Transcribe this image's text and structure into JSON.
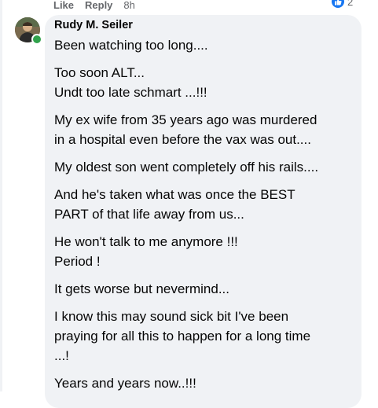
{
  "actions": {
    "like": "Like",
    "reply": "Reply",
    "time": "8h",
    "reaction_count": "2"
  },
  "comment": {
    "author": "Rudy M. Seiler",
    "messages": [
      [
        "Been watching too long...."
      ],
      [
        "Too soon ALT...",
        "Undt too late schmart ...!!!"
      ],
      [
        "My ex wife from 35 years ago was murdered",
        "in a hospital even before the vax was out...."
      ],
      [
        "My oldest son went completely off his rails...."
      ],
      [
        "And he's taken what was once the BEST",
        "PART of that life away from us..."
      ],
      [
        "He won't talk to me anymore !!!",
        "Period !"
      ],
      [
        "It gets worse but nevermind..."
      ],
      [
        "I know this may sound sick bit I've been",
        "praying for all this to happen for a long time",
        "...!"
      ],
      [
        "Years and years now..!!!"
      ]
    ]
  },
  "colors": {
    "bubble": "#f0f2f5",
    "text": "#050505",
    "meta": "#65676b",
    "like_blue": "#1877f2",
    "online": "#31a24c"
  },
  "icons": {
    "reaction": "like-thumb-icon",
    "presence": "online-status-dot"
  }
}
